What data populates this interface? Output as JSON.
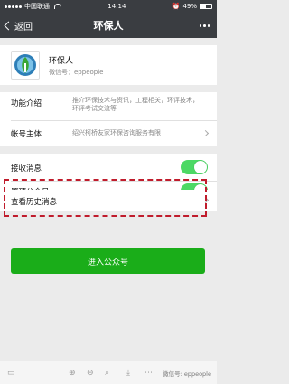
{
  "status_bar": {
    "carrier": "中国联通",
    "time": "14:14",
    "battery": "49%"
  },
  "nav": {
    "back_label": "返回",
    "title": "环保人"
  },
  "profile": {
    "name": "环保人",
    "wechat_id": "微信号：eppeople"
  },
  "info": {
    "intro_label": "功能介绍",
    "intro_value": "推介环保技术与资讯，工程相关，环评技术，环评考试交流等",
    "owner_label": "帐号主体",
    "owner_value": "绍兴柯桥友家环保咨询服务有限"
  },
  "settings": {
    "receive_label": "接收消息",
    "pin_label": "置顶公众号",
    "history_label": "查看历史消息",
    "receive_on": true,
    "pin_on": true
  },
  "enter_button": "进入公众号",
  "toolbar": {
    "watermark": "微信号: eppeople",
    "icons": [
      "window-icon",
      "zoom-in-icon",
      "zoom-out-icon",
      "search-icon",
      "download-icon",
      "more-icon"
    ]
  },
  "colors": {
    "header": "#3a3d41",
    "toggle_on": "#4cd964",
    "button": "#1aad19",
    "highlight": "#c01c2c"
  }
}
